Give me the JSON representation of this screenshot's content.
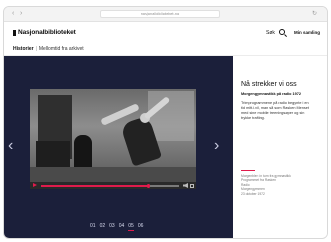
{
  "browser": {
    "url": "nasjonalbiblioteket.no"
  },
  "header": {
    "logo": "Nasjonalbiblioteket",
    "search_label": "Søk",
    "collection_link": "Min samling",
    "breadcrumb": {
      "section": "Historier",
      "page": "Mellomtid fra arkivet"
    }
  },
  "slideshow": {
    "pages": [
      "01",
      "02",
      "03",
      "04",
      "05",
      "06"
    ],
    "active_page": "05",
    "video_progress": 0.78
  },
  "info": {
    "title": "Nå strekker vi oss",
    "subtitle": "Morgengymnastikk på radio 1972",
    "body": "Trimprogrammene på radio begynte i en tid mitt.i.vil, man så som Rasken Menset med sine mobile treeningsøper og sin trykke trafting.",
    "meta": [
      "Morgenbler: in turn fra gymnastikk",
      "Programmet fra Rasken",
      "Radio",
      "Morgengymmen",
      "23 oktober 1972"
    ]
  },
  "colors": {
    "stage_bg": "#1b1f3a",
    "accent": "#e01b4c"
  }
}
